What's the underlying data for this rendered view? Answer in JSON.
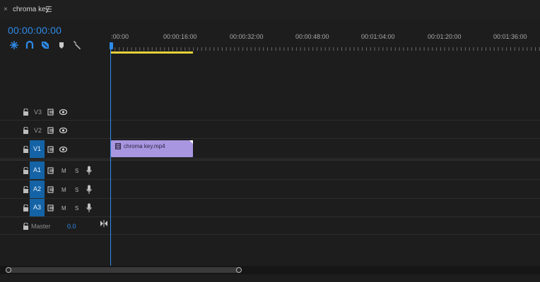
{
  "sequence": {
    "title": "chroma key",
    "close_glyph": "×",
    "menu_glyph": "☰"
  },
  "timecode": "00:00:00:00",
  "tools": [
    {
      "name": "snap-icon"
    },
    {
      "name": "magnet-icon"
    },
    {
      "name": "linked-selection-icon"
    },
    {
      "name": "marker-icon"
    },
    {
      "name": "wrench-icon"
    }
  ],
  "ruler": {
    "labels": [
      ":00:00",
      "00:00:16:00",
      "00:00:32:00",
      "00:00:48:00",
      "00:01:04:00",
      "00:01:20:00",
      "00:01:36:00"
    ]
  },
  "tracks": {
    "video": [
      {
        "id": "V3",
        "label": "V3",
        "target_label": "",
        "targeted": false
      },
      {
        "id": "V2",
        "label": "V2",
        "target_label": "",
        "targeted": false
      },
      {
        "id": "V1",
        "label": "V1",
        "target_label": "V1",
        "targeted": true
      }
    ],
    "audio": [
      {
        "id": "A1",
        "target_label": "A1",
        "mute": "M",
        "solo": "S",
        "targeted": true
      },
      {
        "id": "A2",
        "target_label": "A2",
        "mute": "M",
        "solo": "S",
        "targeted": true
      },
      {
        "id": "A3",
        "target_label": "A3",
        "mute": "M",
        "solo": "S",
        "targeted": true
      }
    ],
    "master": {
      "label": "Master",
      "value": "0.0"
    }
  },
  "clip": {
    "name": "chroma key.mp4",
    "color": "#a896e0"
  },
  "colors": {
    "accent": "#2d8ceb",
    "work_area": "#e6d13a",
    "clip": "#a896e0",
    "target": "#1463a6"
  }
}
